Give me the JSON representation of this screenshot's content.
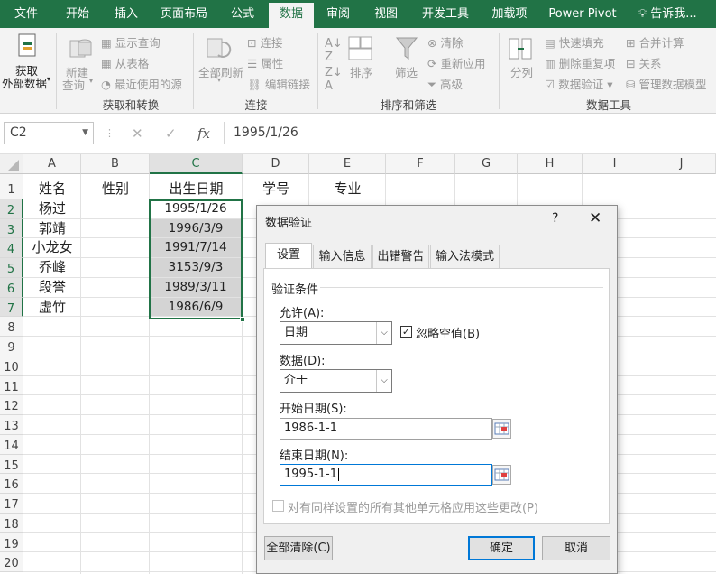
{
  "ribbon_tabs": [
    {
      "label": "文件",
      "active": false
    },
    {
      "label": "开始",
      "active": false
    },
    {
      "label": "插入",
      "active": false
    },
    {
      "label": "页面布局",
      "active": false
    },
    {
      "label": "公式",
      "active": false
    },
    {
      "label": "数据",
      "active": true
    },
    {
      "label": "审阅",
      "active": false
    },
    {
      "label": "视图",
      "active": false
    },
    {
      "label": "开发工具",
      "active": false
    },
    {
      "label": "加载项",
      "active": false
    },
    {
      "label": "Power Pivot",
      "active": false
    }
  ],
  "tell_me": "告诉我...",
  "ribbon": {
    "get_external_data": "获取\n外部数据",
    "get_external_data_l1": "获取",
    "get_external_data_l2": "外部数据",
    "new_query_l1": "新建",
    "new_query_l2": "查询",
    "show_queries": "显示查询",
    "from_table": "从表格",
    "recent_sources": "最近使用的源",
    "group_get_transform": "获取和转换",
    "refresh_all": "全部刷新",
    "connections": "连接",
    "properties": "属性",
    "edit_links": "编辑链接",
    "group_connections": "连接",
    "sort": "排序",
    "filter": "筛选",
    "clear": "清除",
    "reapply": "重新应用",
    "advanced": "高级",
    "group_sort_filter": "排序和筛选",
    "text_to_columns": "分列",
    "flash_fill": "快速填充",
    "remove_duplicates": "删除重复项",
    "data_validation": "数据验证",
    "consolidate": "合并计算",
    "relationships": "关系",
    "manage_data_model": "管理数据模型",
    "group_data_tools": "数据工具"
  },
  "formula_bar": {
    "name_box": "C2",
    "fx": "fx",
    "formula": "1995/1/26"
  },
  "sheet": {
    "columns": [
      "A",
      "B",
      "C",
      "D",
      "E",
      "F",
      "G",
      "H",
      "I",
      "J"
    ],
    "rows": [
      "1",
      "2",
      "3",
      "4",
      "5",
      "6",
      "7",
      "8",
      "9",
      "10",
      "11",
      "12",
      "13",
      "14",
      "15",
      "16",
      "17",
      "18",
      "19",
      "20"
    ],
    "headers": [
      "姓名",
      "性别",
      "出生日期",
      "学号",
      "专业"
    ],
    "names": [
      "杨过",
      "郭靖",
      "小龙女",
      "乔峰",
      "段誉",
      "虚竹"
    ],
    "dates": [
      "1995/1/26",
      "1996/3/9",
      "1991/7/14",
      "3153/9/3",
      "1989/3/11",
      "1986/6/9"
    ]
  },
  "dialog": {
    "title": "数据验证",
    "help": "?",
    "close": "✕",
    "tabs": [
      "设置",
      "输入信息",
      "出错警告",
      "输入法模式"
    ],
    "section_title": "验证条件",
    "allow_label": "允许(A):",
    "allow_value": "日期",
    "ignore_blank_label": "忽略空值(B)",
    "ignore_blank_checked": true,
    "data_label": "数据(D):",
    "data_value": "介于",
    "start_label": "开始日期(S):",
    "start_value": "1986-1-1",
    "end_label": "结束日期(N):",
    "end_value": "1995-1-1",
    "apply_all_label": "对有同样设置的所有其他单元格应用这些更改(P)",
    "clear_all_button": "全部清除(C)",
    "ok_button": "确定",
    "cancel_button": "取消"
  },
  "colors": {
    "excel_green": "#217346",
    "dialog_bg": "#f0f0f0",
    "focus_blue": "#0078d7",
    "selection_fill": "#d4d4d4"
  }
}
